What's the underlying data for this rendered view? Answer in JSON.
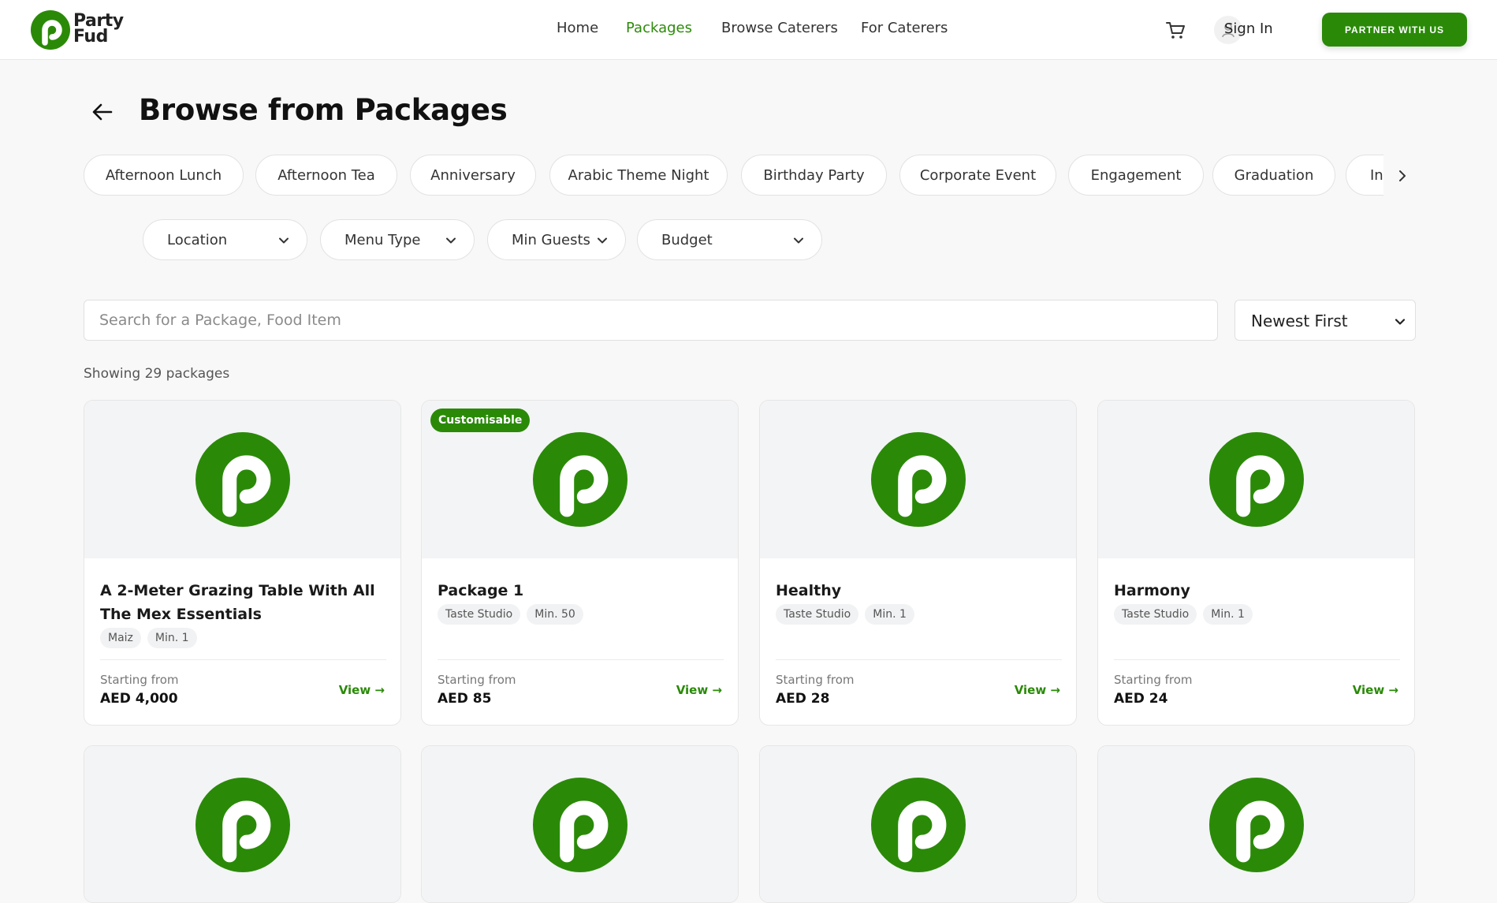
{
  "brand": {
    "name_line1": "Party",
    "name_line2": "Fud",
    "accent": "#2a8a08"
  },
  "nav": {
    "home": "Home",
    "packages": "Packages",
    "browse_caterers": "Browse Caterers",
    "for_caterers": "For Caterers",
    "active": "Packages"
  },
  "header": {
    "sign_in": "Sign In",
    "partner_button": "PARTNER WITH US"
  },
  "page": {
    "title": "Browse from Packages"
  },
  "categories": [
    "Afternoon Lunch",
    "Afternoon Tea",
    "Anniversary",
    "Arabic Theme Night",
    "Birthday Party",
    "Corporate Event",
    "Engagement",
    "Graduation",
    "In"
  ],
  "filters": {
    "location": "Location",
    "menu_type": "Menu Type",
    "min_guests": "Min Guests",
    "budget": "Budget"
  },
  "search": {
    "placeholder": "Search for a Package, Food Item",
    "value": ""
  },
  "sort": {
    "selected": "Newest First"
  },
  "results": {
    "count_text": "Showing 29 packages"
  },
  "cards": [
    {
      "badge": "",
      "title": "A 2-Meter Grazing Table With All The Mex Essentials",
      "caterer": "Maiz",
      "min": "Min. 1",
      "starting_label": "Starting from",
      "price": "AED 4,000",
      "view": "View →"
    },
    {
      "badge": "Customisable",
      "title": "Package 1",
      "caterer": "Taste Studio",
      "min": "Min. 50",
      "starting_label": "Starting from",
      "price": "AED 85",
      "view": "View →"
    },
    {
      "badge": "",
      "title": "Healthy",
      "caterer": "Taste Studio",
      "min": "Min. 1",
      "starting_label": "Starting from",
      "price": "AED 28",
      "view": "View →"
    },
    {
      "badge": "",
      "title": "Harmony",
      "caterer": "Taste Studio",
      "min": "Min. 1",
      "starting_label": "Starting from",
      "price": "AED 24",
      "view": "View →"
    }
  ],
  "icons": {
    "logo": "partyfud-p-logo",
    "cart": "cart-icon",
    "user": "user-icon",
    "back": "arrow-left-icon",
    "chevron": "chevron-down-icon",
    "scroll": "chevron-right-icon",
    "placeholder": "partyfud-p-logo"
  }
}
